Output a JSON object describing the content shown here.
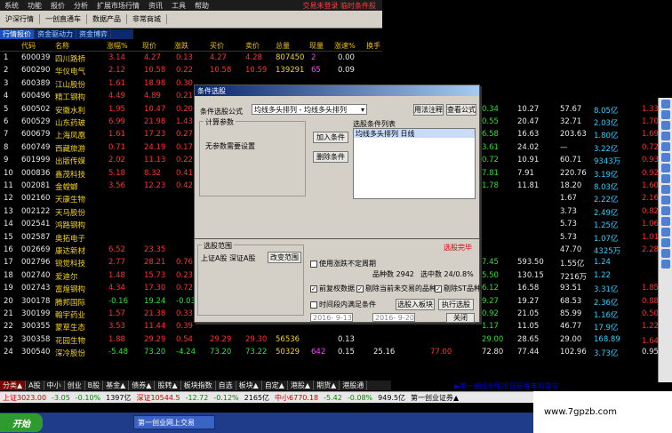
{
  "menu": {
    "items": [
      "系统",
      "功能",
      "报价",
      "分析",
      "扩展市场行情",
      "资讯",
      "工具",
      "帮助"
    ],
    "login": "交易未登录  临时条件股"
  },
  "toolbar": {
    "items": [
      "沪深行情",
      "一创直通车",
      "数据产品",
      "非常商城"
    ]
  },
  "subtabs": [
    "行情报价",
    "资金驱动力",
    "资金博弈"
  ],
  "headers": [
    "代码",
    "名称",
    "涨幅%",
    "现价",
    "涨跌",
    "买价",
    "卖价",
    "总量",
    "现量",
    "涨速%",
    "换手"
  ],
  "rows": [
    {
      "n": "1",
      "code": "600039",
      "name": "四川路桥",
      "chg": "3.14",
      "price": "4.27",
      "d": "0.13",
      "buy": "4.27",
      "sell": "4.28",
      "vol": "807450",
      "now": "2",
      "spd": "0.00",
      "c": "r",
      "r": [
        "",
        "",
        "",
        "",
        ""
      ]
    },
    {
      "n": "2",
      "code": "600290",
      "name": "华仪电气",
      "chg": "2.12",
      "price": "10.58",
      "d": "0.22",
      "buy": "10.58",
      "sell": "10.59",
      "vol": "139291",
      "now": "65",
      "spd": "0.09",
      "c": "r",
      "r": [
        "",
        "",
        "",
        "",
        ""
      ]
    },
    {
      "n": "3",
      "code": "600389",
      "name": "江山股份",
      "chg": "1.61",
      "price": "18.98",
      "d": "0.30",
      "buy": "",
      "sell": "",
      "vol": "",
      "now": "",
      "spd": "",
      "c": "r",
      "r": [
        "",
        "",
        "",
        "",
        ""
      ]
    },
    {
      "n": "4",
      "code": "600496",
      "name": "精工钢构",
      "chg": "4.49",
      "price": "4.89",
      "d": "0.21",
      "buy": "",
      "sell": "",
      "vol": "",
      "now": "",
      "spd": "",
      "c": "r",
      "r": [
        "",
        "",
        "",
        "",
        ""
      ]
    },
    {
      "n": "5",
      "code": "600502",
      "name": "安徽水利",
      "chg": "1.95",
      "price": "10.47",
      "d": "0.20",
      "buy": "",
      "sell": "",
      "vol": "",
      "now": "",
      "spd": "",
      "c": "r",
      "r": [
        "0.34",
        "10.27",
        "57.67",
        "8.05亿",
        "1.33"
      ]
    },
    {
      "n": "6",
      "code": "600529",
      "name": "山东药玻",
      "chg": "6.99",
      "price": "21.98",
      "d": "1.43",
      "buy": "",
      "sell": "",
      "vol": "",
      "now": "",
      "spd": "",
      "c": "r",
      "r": [
        "0.55",
        "20.47",
        "32.71",
        "2.03亿",
        "1.70"
      ]
    },
    {
      "n": "7",
      "code": "600679",
      "name": "上海凤凰",
      "chg": "1.61",
      "price": "17.23",
      "d": "0.27",
      "buy": "",
      "sell": "",
      "vol": "",
      "now": "",
      "spd": "",
      "c": "r",
      "r": [
        "6.58",
        "16.63",
        "203.63",
        "1.80亿",
        "1.69"
      ]
    },
    {
      "n": "8",
      "code": "600749",
      "name": "西藏旅游",
      "chg": "0.71",
      "price": "24.19",
      "d": "0.17",
      "buy": "",
      "sell": "",
      "vol": "",
      "now": "",
      "spd": "",
      "c": "r",
      "r": [
        "3.61",
        "24.02",
        "—",
        "3.22亿",
        "0.72"
      ]
    },
    {
      "n": "9",
      "code": "601999",
      "name": "出版传媒",
      "chg": "2.02",
      "price": "11.13",
      "d": "0.22",
      "buy": "",
      "sell": "",
      "vol": "",
      "now": "",
      "spd": "",
      "c": "r",
      "r": [
        "0.72",
        "10.91",
        "60.71",
        "9343万",
        "0.93"
      ]
    },
    {
      "n": "10",
      "code": "000836",
      "name": "鑫茂科技",
      "chg": "5.18",
      "price": "8.32",
      "d": "0.41",
      "buy": "",
      "sell": "",
      "vol": "",
      "now": "",
      "spd": "",
      "c": "r",
      "r": [
        "7.81",
        "7.91",
        "220.76",
        "3.19亿",
        "0.92"
      ]
    },
    {
      "n": "11",
      "code": "002081",
      "name": "金螳螂",
      "chg": "3.56",
      "price": "12.23",
      "d": "0.42",
      "buy": "",
      "sell": "",
      "vol": "",
      "now": "",
      "spd": "",
      "c": "r",
      "r": [
        "1.78",
        "11.81",
        "18.20",
        "8.03亿",
        "1.60"
      ]
    },
    {
      "n": "12",
      "code": "002160",
      "name": "天康生物",
      "chg": "",
      "price": "",
      "d": "",
      "buy": "",
      "sell": "",
      "vol": "",
      "now": "",
      "spd": "",
      "c": "r",
      "r": [
        "",
        "",
        "1.67",
        "2.22亿",
        "2.16"
      ]
    },
    {
      "n": "13",
      "code": "002122",
      "name": "天马股份",
      "chg": "",
      "price": "",
      "d": "",
      "buy": "",
      "sell": "",
      "vol": "",
      "now": "",
      "spd": "",
      "c": "r",
      "r": [
        "",
        "",
        "3.73",
        "2.49亿",
        "0.82"
      ]
    },
    {
      "n": "14",
      "code": "002541",
      "name": "鸿路钢构",
      "chg": "",
      "price": "",
      "d": "",
      "buy": "",
      "sell": "",
      "vol": "",
      "now": "",
      "spd": "",
      "c": "r",
      "r": [
        "",
        "",
        "5.73",
        "1.25亿",
        "1.06"
      ]
    },
    {
      "n": "15",
      "code": "002587",
      "name": "奥拓电子",
      "chg": "",
      "price": "",
      "d": "",
      "buy": "",
      "sell": "",
      "vol": "",
      "now": "",
      "spd": "",
      "c": "r",
      "r": [
        "",
        "",
        "5.73",
        "1.07亿",
        "1.01"
      ]
    },
    {
      "n": "16",
      "code": "002669",
      "name": "康达新材",
      "chg": "6.52",
      "price": "23.35",
      "d": "",
      "buy": "",
      "sell": "",
      "vol": "",
      "now": "",
      "spd": "",
      "c": "r",
      "r": [
        "",
        "",
        "47.70",
        "4325万",
        "2.28"
      ]
    },
    {
      "n": "17",
      "code": "002796",
      "name": "锐觉科技",
      "chg": "2.77",
      "price": "28.21",
      "d": "0.76",
      "buy": "",
      "sell": "",
      "vol": "",
      "now": "",
      "spd": "",
      "c": "r",
      "r": [
        "7.45",
        "593.50",
        "1.55亿",
        "1.24",
        ""
      ]
    },
    {
      "n": "18",
      "code": "002740",
      "name": "爱迪尔",
      "chg": "1.48",
      "price": "15.73",
      "d": "0.23",
      "buy": "",
      "sell": "",
      "vol": "",
      "now": "",
      "spd": "",
      "c": "r",
      "r": [
        "5.50",
        "130.15",
        "7216万",
        "1.22",
        ""
      ]
    },
    {
      "n": "19",
      "code": "002743",
      "name": "富煌钢构",
      "chg": "4.34",
      "price": "17.30",
      "d": "0.72",
      "buy": "",
      "sell": "",
      "vol": "",
      "now": "",
      "spd": "",
      "c": "r",
      "r": [
        "6.12",
        "16.58",
        "93.51",
        "3.31亿",
        "1.85"
      ]
    },
    {
      "n": "20",
      "code": "300178",
      "name": "腾邦国际",
      "chg": "-0.16",
      "price": "19.24",
      "d": "-0.03",
      "buy": "",
      "sell": "",
      "vol": "",
      "now": "",
      "spd": "",
      "c": "g",
      "r": [
        "9.27",
        "19.27",
        "68.53",
        "2.36亿",
        "0.88"
      ]
    },
    {
      "n": "21",
      "code": "300199",
      "name": "翰宇药业",
      "chg": "1.57",
      "price": "21.38",
      "d": "0.33",
      "buy": "",
      "sell": "",
      "vol": "",
      "now": "",
      "spd": "",
      "c": "r",
      "r": [
        "0.92",
        "21.05",
        "85.99",
        "1.16亿",
        "0.50"
      ]
    },
    {
      "n": "22",
      "code": "300355",
      "name": "蒙草生态",
      "chg": "3.53",
      "price": "11.44",
      "d": "0.39",
      "buy": "",
      "sell": "",
      "vol": "",
      "now": "",
      "spd": "",
      "c": "r",
      "r": [
        "1.17",
        "11.05",
        "46.77",
        "17.9亿",
        "1.22"
      ]
    },
    {
      "n": "23",
      "code": "300358",
      "name": "花园生物",
      "chg": "1.88",
      "price": "29.29",
      "d": "0.54",
      "buy": "29.29",
      "sell": "29.30",
      "vol": "56536",
      "now": "",
      "spd": "0.13",
      "c": "r",
      "r": [
        "29.00",
        "28.65",
        "29.00",
        "168.89",
        "1.64亿"
      ]
    },
    {
      "n": "24",
      "code": "300540",
      "name": "深冷股份",
      "chg": "-5.48",
      "price": "73.20",
      "d": "-4.24",
      "buy": "73.20",
      "sell": "73.22",
      "vol": "50329",
      "now": "642",
      "spd": "0.15",
      "c": "g",
      "extra": [
        "25.16",
        "77.00",
        "72.80",
        "77.44",
        "102.96",
        "3.73亿",
        "0.95"
      ]
    }
  ],
  "bottomtabs": [
    "分类▲",
    "A股",
    "中小",
    "创业",
    "B股",
    "基金▲",
    "债券▲",
    "股转▲",
    "板块指数",
    "自选",
    "板块▲",
    "自定▲",
    "港股▲",
    "期货▲",
    "港股通"
  ],
  "status": {
    "sh": "上证3023.00",
    "sh_chg": "-3.05",
    "sh_pct": "-0.10%",
    "sh_amt": "1397亿",
    "sz": "深证10544.5",
    "sz_chg": "-12.72",
    "sz_pct": "-0.12%",
    "sz_amt": "2165亿",
    "zx": "中小6770.18",
    "zx_chg": "-5.42",
    "zx_pct": "-0.08%",
    "zx_amt": "949.5亿",
    "news": "第一创业证券▲",
    "notice": "▶第一创业9月20日新股申购提示"
  },
  "taskbar": {
    "start": "开始",
    "item": "第一创业网上交易"
  },
  "watermark": "www.7gpzb.com",
  "dialog": {
    "title": "条件选股",
    "formula_label": "条件选股公式",
    "formula_value": "均线多头排列 - 均线多头排列",
    "use_btn": "用法注释",
    "view_btn": "查看公式",
    "params_title": "计算参数",
    "no_params": "无参数需要设置",
    "list_title": "选股条件列表",
    "list_item": "均线多头排列  日线",
    "add_btn": "加入条件",
    "del_btn": "删除条件",
    "range_title": "选股范围",
    "range_value": "上证A股 深证A股",
    "range_btn": "改变范围",
    "use_days": "使用涨跌不定周期",
    "count": "品种数 2942",
    "selected": "选中数 24/0.8%",
    "prev_rights": "前复权数据",
    "exclude_stop": "剔除当前未交易的品种",
    "exclude_st": "剔除ST品种",
    "time_cond": "时间段内满足条件",
    "date_from": "2016- 9-13",
    "date_to": "2016- 9-20",
    "put_btn": "选股入板块",
    "exec_btn": "执行选股",
    "close_btn": "关闭",
    "alert": "选股完毕"
  },
  "right_icons": [
    "icon1",
    "icon2",
    "icon3",
    "icon4",
    "icon5",
    "icon6",
    "icon7",
    "icon8",
    "icon9",
    "icon10",
    "icon11",
    "icon12",
    "icon13",
    "icon14",
    "icon15",
    "icon16"
  ]
}
